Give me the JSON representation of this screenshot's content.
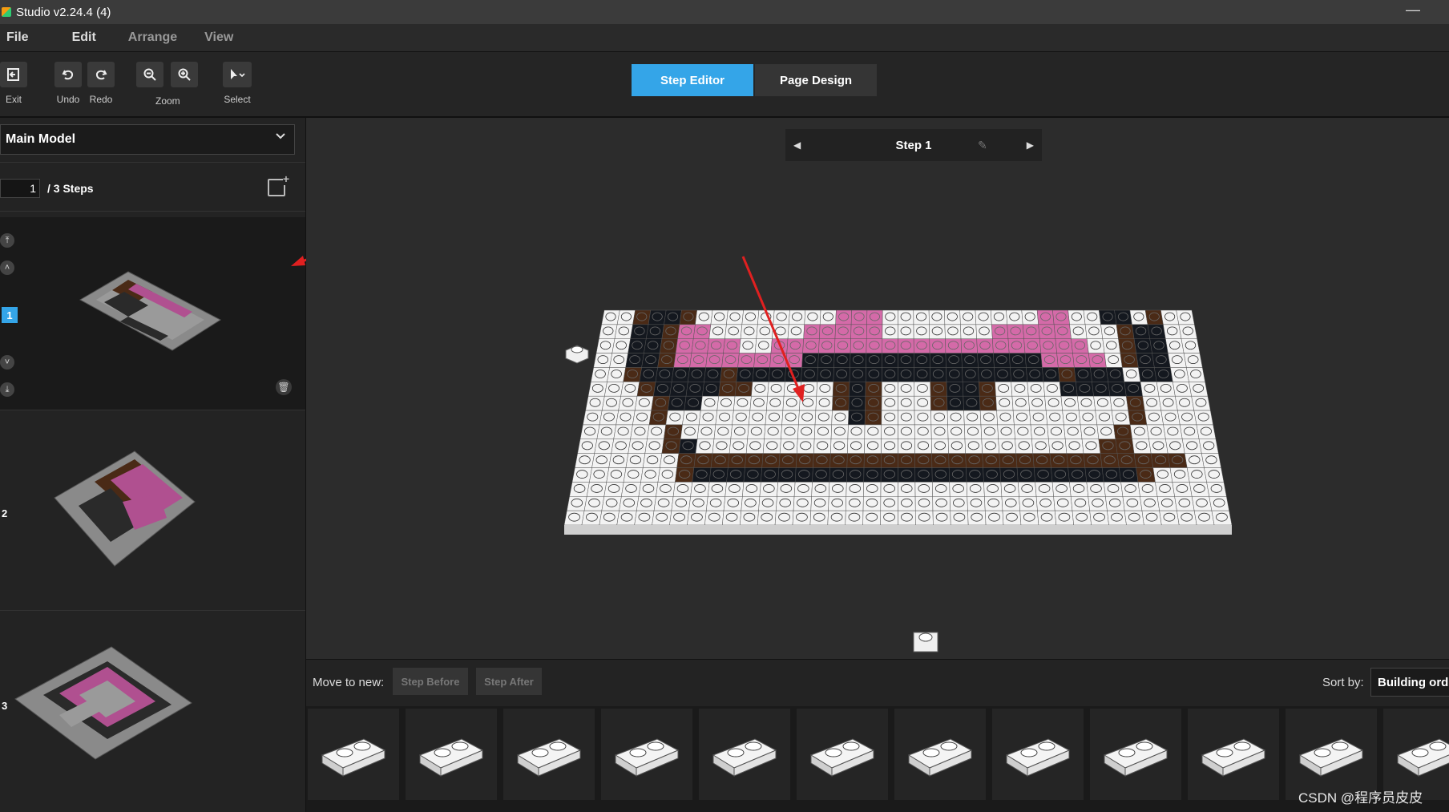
{
  "window": {
    "title": "Studio v2.24.4 (4)",
    "minimize": "—"
  },
  "menu": {
    "items": [
      "File",
      "Edit",
      "Arrange",
      "View"
    ]
  },
  "toolbar": {
    "exit": "Exit",
    "undo": "Undo",
    "redo": "Redo",
    "zoom": "Zoom",
    "select": "Select"
  },
  "modes": {
    "step_editor": "Step Editor",
    "page_design": "Page Design",
    "active": "Step Editor"
  },
  "sidebar": {
    "model": "Main Model",
    "step_input": "1",
    "steps_total": "/ 3 Steps",
    "steps": [
      {
        "num": "1",
        "selected": true
      },
      {
        "num": "2",
        "selected": false
      },
      {
        "num": "3",
        "selected": false
      }
    ]
  },
  "canvas": {
    "step_label": "Step 1"
  },
  "bottom": {
    "move_to_new": "Move to new:",
    "step_before": "Step Before",
    "step_after": "Step After",
    "sort_by": "Sort by:",
    "sort_value": "Building orde"
  },
  "parts_count": 12,
  "watermark": "CSDN @程序员皮皮",
  "colors": {
    "accent": "#34a5e8",
    "pink": "#d46aa8",
    "brown": "#4a2a16",
    "black": "#14181f",
    "white": "#f3f3f3",
    "arrow": "#e02020"
  }
}
